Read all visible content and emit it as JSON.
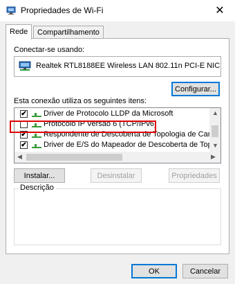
{
  "window": {
    "title": "Propriedades de Wi-Fi",
    "close_glyph": "✕"
  },
  "tabs": [
    {
      "label": "Rede",
      "active": true
    },
    {
      "label": "Compartilhamento",
      "active": false
    }
  ],
  "connect_using": {
    "label": "Conectar-se usando:",
    "adapter": "Realtek RTL8188EE Wireless LAN 802.11n PCI-E NIC",
    "configure_button": "Configurar..."
  },
  "items_section": {
    "label": "Esta conexão utiliza os seguintes itens:",
    "items": [
      {
        "label": "Driver de Protocolo LLDP da Microsoft",
        "checked": true
      },
      {
        "label": "Protocolo IP Versão 6 (TCP/IPv6)",
        "checked": false,
        "highlighted": true
      },
      {
        "label": "Respondente de Descoberta de Topologia de Camada",
        "checked": true
      },
      {
        "label": "Driver de E/S do Mapeador de Descoberta de Topologia",
        "checked": true
      }
    ]
  },
  "item_buttons": {
    "install": "Instalar...",
    "uninstall": "Desinstalar",
    "properties": "Propriedades"
  },
  "description": {
    "label": "Descrição",
    "text": ""
  },
  "footer": {
    "ok": "OK",
    "cancel": "Cancelar"
  },
  "colors": {
    "highlight_border": "#e00000",
    "focus_border": "#0078d7"
  }
}
